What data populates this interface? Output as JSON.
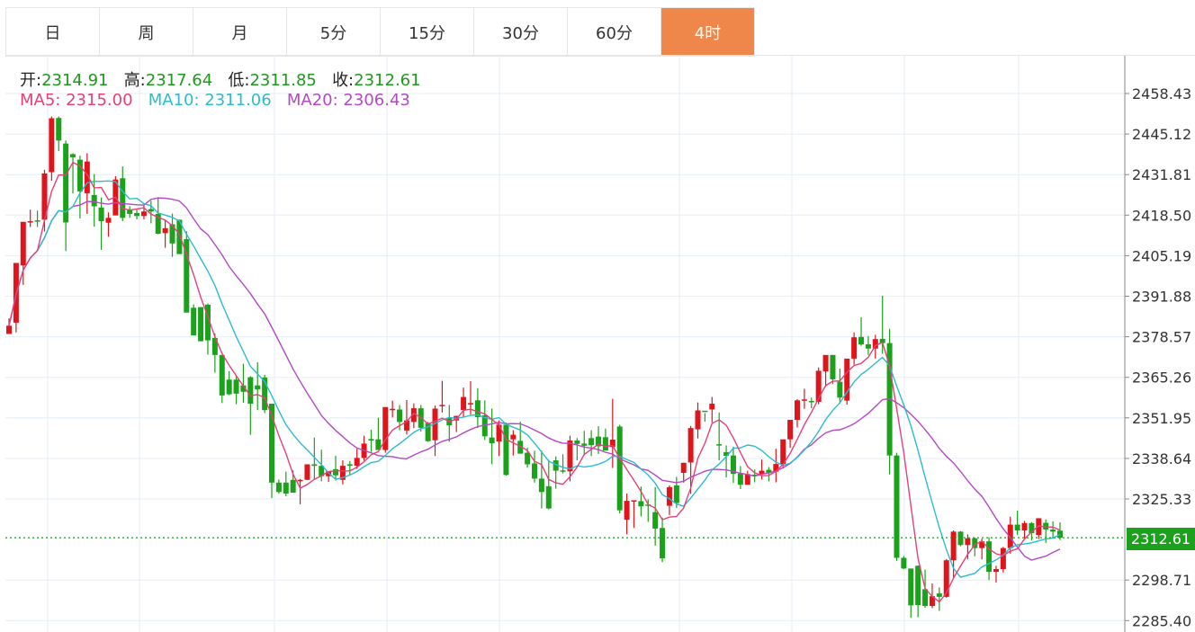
{
  "tabs": [
    {
      "label": "日",
      "active": false
    },
    {
      "label": "周",
      "active": false
    },
    {
      "label": "月",
      "active": false
    },
    {
      "label": "5分",
      "active": false
    },
    {
      "label": "15分",
      "active": false
    },
    {
      "label": "30分",
      "active": false
    },
    {
      "label": "60分",
      "active": false
    },
    {
      "label": "4时",
      "active": true
    }
  ],
  "ohlc": {
    "open_label": "开:",
    "open": "2314.91",
    "high_label": "高:",
    "high": "2317.64",
    "low_label": "低:",
    "low": "2311.85",
    "close_label": "收:",
    "close": "2312.61"
  },
  "ma": {
    "ma5_label": "MA5:",
    "ma5": "2315.00",
    "ma10_label": "MA10:",
    "ma10": "2311.06",
    "ma20_label": "MA20:",
    "ma20": "2306.43"
  },
  "current_price_label": "2312.61",
  "colors": {
    "up": "#e0141b",
    "down": "#1ba11b",
    "ma5": "#e6407a",
    "ma10": "#2bbcd0",
    "ma20": "#b548c6",
    "accent": "#f0874a",
    "grid": "#e4eef6"
  },
  "chart_data": {
    "type": "candlestick",
    "y_ticks": [
      "2458.43",
      "2445.12",
      "2431.81",
      "2418.50",
      "2405.19",
      "2391.88",
      "2378.57",
      "2365.26",
      "2351.95",
      "2338.64",
      "2325.33",
      "2312.61",
      "2298.71",
      "2285.40"
    ],
    "ylim": [
      2282.5,
      2466.0
    ],
    "current_price": 2312.61,
    "candles": [
      [
        2379.5,
        2384.6,
        2379.5,
        2382.2
      ],
      [
        2383.2,
        2402.2,
        2380.0,
        2402.8
      ],
      [
        2402.0,
        2416.3,
        2395.6,
        2416.3
      ],
      [
        2416.4,
        2420.3,
        2414.6,
        2416.5
      ],
      [
        2416.8,
        2420.0,
        2414.6,
        2416.5
      ],
      [
        2417.0,
        2433.4,
        2413.1,
        2432.2
      ],
      [
        2432.6,
        2450.9,
        2429.8,
        2450.3
      ],
      [
        2450.4,
        2450.9,
        2439.5,
        2443.0
      ],
      [
        2442.0,
        2443.0,
        2406.7,
        2416.1
      ],
      [
        2438.5,
        2438.8,
        2425.6,
        2437.5
      ],
      [
        2436.7,
        2438.0,
        2417.4,
        2426.3
      ],
      [
        2425.7,
        2438.8,
        2418.9,
        2436.1
      ],
      [
        2425.1,
        2432.0,
        2414.7,
        2421.4
      ],
      [
        2421.0,
        2424.3,
        2407.1,
        2416.5
      ],
      [
        2416.0,
        2419.4,
        2411.4,
        2417.6
      ],
      [
        2418.4,
        2431.3,
        2418.4,
        2430.2
      ],
      [
        2430.6,
        2434.5,
        2416.5,
        2417.6
      ],
      [
        2420.4,
        2421.4,
        2417.6,
        2418.9
      ],
      [
        2419.2,
        2420.2,
        2417.1,
        2418.2
      ],
      [
        2418.2,
        2421.7,
        2417.1,
        2419.7
      ],
      [
        2420.5,
        2423.2,
        2415.8,
        2419.7
      ],
      [
        2418.9,
        2424.4,
        2412.2,
        2412.4
      ],
      [
        2412.6,
        2416.8,
        2407.8,
        2414.2
      ],
      [
        2415.5,
        2419.0,
        2404.8,
        2409.2
      ],
      [
        2417.0,
        2417.0,
        2406.0,
        2405.7
      ],
      [
        2410.6,
        2413.2,
        2386.8,
        2386.5
      ],
      [
        2388.1,
        2389.2,
        2379.8,
        2379.0
      ],
      [
        2388.3,
        2388.3,
        2377.1,
        2377.1
      ],
      [
        2389.1,
        2389.5,
        2372.7,
        2377.4
      ],
      [
        2378.2,
        2379.7,
        2366.8,
        2372.6
      ],
      [
        2372.6,
        2372.6,
        2356.8,
        2359.3
      ],
      [
        2364.5,
        2367.3,
        2359.4,
        2359.7
      ],
      [
        2364.5,
        2365.7,
        2356.4,
        2359.9
      ],
      [
        2362.6,
        2369.7,
        2356.9,
        2360.5
      ],
      [
        2365.3,
        2365.6,
        2346.4,
        2356.6
      ],
      [
        2362.6,
        2370.2,
        2354.5,
        2361.3
      ],
      [
        2365.2,
        2366.1,
        2353.5,
        2354.5
      ],
      [
        2356.6,
        2356.6,
        2325.6,
        2330.7
      ],
      [
        2330.7,
        2331.7,
        2327.1,
        2327.6
      ],
      [
        2330.7,
        2334.3,
        2326.2,
        2327.1
      ],
      [
        2331.6,
        2334.7,
        2327.7,
        2327.4
      ],
      [
        2331.6,
        2331.9,
        2323.6,
        2331.6
      ],
      [
        2331.6,
        2336.7,
        2331.6,
        2336.7
      ],
      [
        2336.7,
        2345.5,
        2331.6,
        2336.2
      ],
      [
        2336.2,
        2341.5,
        2331.1,
        2332.8
      ],
      [
        2332.8,
        2333.9,
        2330.9,
        2334.4
      ],
      [
        2335.1,
        2339.5,
        2331.4,
        2333.1
      ],
      [
        2331.6,
        2338.0,
        2330.1,
        2336.2
      ],
      [
        2336.7,
        2337.8,
        2333.2,
        2336.2
      ],
      [
        2336.2,
        2341.8,
        2335.2,
        2338.8
      ],
      [
        2338.8,
        2346.1,
        2337.9,
        2343.5
      ],
      [
        2345.0,
        2348.1,
        2340.8,
        2344.5
      ],
      [
        2344.9,
        2352.0,
        2341.8,
        2341.4
      ],
      [
        2341.4,
        2350.6,
        2340.5,
        2355.5
      ],
      [
        2354.8,
        2357.6,
        2352.1,
        2354.9
      ],
      [
        2354.7,
        2356.2,
        2347.9,
        2350.6
      ],
      [
        2347.8,
        2357.8,
        2346.5,
        2351.1
      ],
      [
        2350.6,
        2356.7,
        2348.6,
        2355.1
      ],
      [
        2355.1,
        2356.2,
        2347.5,
        2348.7
      ],
      [
        2350.3,
        2350.6,
        2344.1,
        2344.3
      ],
      [
        2344.6,
        2356.0,
        2339.4,
        2355.0
      ],
      [
        2356.1,
        2364.1,
        2353.7,
        2356.2
      ],
      [
        2351.9,
        2356.2,
        2344.1,
        2349.5
      ],
      [
        2351.1,
        2352.6,
        2347.3,
        2352.6
      ],
      [
        2354.5,
        2361.9,
        2352.2,
        2358.8
      ],
      [
        2356.8,
        2364.0,
        2353.1,
        2356.8
      ],
      [
        2357.7,
        2361.7,
        2348.6,
        2352.2
      ],
      [
        2352.8,
        2357.7,
        2344.7,
        2345.9
      ],
      [
        2345.5,
        2355.0,
        2336.7,
        2343.6
      ],
      [
        2344.2,
        2351.1,
        2339.4,
        2349.7
      ],
      [
        2349.7,
        2350.4,
        2333.0,
        2333.2
      ],
      [
        2344.9,
        2347.9,
        2339.6,
        2346.4
      ],
      [
        2344.4,
        2350.7,
        2340.2,
        2340.2
      ],
      [
        2340.5,
        2342.2,
        2335.6,
        2336.7
      ],
      [
        2337.0,
        2341.2,
        2330.7,
        2332.0
      ],
      [
        2332.0,
        2341.2,
        2322.2,
        2327.6
      ],
      [
        2329.5,
        2338.2,
        2321.9,
        2322.2
      ],
      [
        2338.0,
        2339.3,
        2328.7,
        2334.6
      ],
      [
        2334.7,
        2340.0,
        2333.7,
        2334.4
      ],
      [
        2334.4,
        2346.1,
        2331.1,
        2344.5
      ],
      [
        2344.5,
        2345.3,
        2338.0,
        2343.4
      ],
      [
        2343.5,
        2347.7,
        2339.7,
        2342.8
      ],
      [
        2345.3,
        2347.9,
        2339.4,
        2343.0
      ],
      [
        2345.8,
        2349.2,
        2340.1,
        2342.6
      ],
      [
        2345.6,
        2348.4,
        2341.4,
        2341.2
      ],
      [
        2342.4,
        2358.2,
        2335.5,
        2344.8
      ],
      [
        2349.1,
        2349.7,
        2320.6,
        2321.6
      ],
      [
        2318.5,
        2327.1,
        2313.7,
        2324.7
      ],
      [
        2324.7,
        2324.7,
        2315.8,
        2324.9
      ],
      [
        2324.6,
        2329.4,
        2319.6,
        2322.9
      ],
      [
        2323.5,
        2325.2,
        2317.8,
        2323.4
      ],
      [
        2321.0,
        2329.2,
        2310.0,
        2315.6
      ],
      [
        2315.8,
        2319.2,
        2304.6,
        2305.8
      ],
      [
        2323.1,
        2329.8,
        2320.0,
        2329.2
      ],
      [
        2329.8,
        2332.6,
        2322.4,
        2324.0
      ],
      [
        2333.9,
        2337.2,
        2330.7,
        2337.2
      ],
      [
        2337.3,
        2349.3,
        2327.0,
        2348.6
      ],
      [
        2348.2,
        2357.0,
        2345.2,
        2354.4
      ],
      [
        2354.3,
        2353.5,
        2350.7,
        2353.9
      ],
      [
        2354.7,
        2358.8,
        2350.5,
        2356.6
      ],
      [
        2343.3,
        2353.7,
        2338.0,
        2343.1
      ],
      [
        2340.7,
        2342.9,
        2332.4,
        2339.5
      ],
      [
        2339.6,
        2342.5,
        2330.6,
        2333.6
      ],
      [
        2333.7,
        2336.1,
        2328.6,
        2330.0
      ],
      [
        2330.0,
        2334.6,
        2330.0,
        2333.5
      ],
      [
        2333.3,
        2335.0,
        2330.8,
        2333.2
      ],
      [
        2333.5,
        2338.3,
        2331.7,
        2334.6
      ],
      [
        2334.9,
        2335.8,
        2331.1,
        2333.8
      ],
      [
        2334.3,
        2341.8,
        2330.8,
        2336.8
      ],
      [
        2336.8,
        2344.8,
        2335.3,
        2344.9
      ],
      [
        2344.9,
        2351.3,
        2342.1,
        2351.3
      ],
      [
        2351.3,
        2358.1,
        2348.8,
        2357.7
      ],
      [
        2357.7,
        2361.5,
        2354.9,
        2358.0
      ],
      [
        2357.5,
        2358.6,
        2355.1,
        2357.2
      ],
      [
        2357.2,
        2368.5,
        2356.4,
        2367.4
      ],
      [
        2367.2,
        2371.2,
        2362.2,
        2372.6
      ],
      [
        2372.6,
        2372.6,
        2363.0,
        2364.6
      ],
      [
        2363.8,
        2368.1,
        2356.7,
        2358.6
      ],
      [
        2357.6,
        2371.1,
        2356.3,
        2371.4
      ],
      [
        2371.4,
        2380.0,
        2369.4,
        2378.4
      ],
      [
        2378.5,
        2385.0,
        2375.6,
        2376.1
      ],
      [
        2376.1,
        2378.8,
        2372.6,
        2374.7
      ],
      [
        2374.7,
        2379.2,
        2371.4,
        2377.8
      ],
      [
        2377.9,
        2392.0,
        2373.0,
        2376.5
      ],
      [
        2376.5,
        2381.2,
        2333.4,
        2339.6
      ],
      [
        2339.6,
        2340.5,
        2305.0,
        2306.0
      ],
      [
        2306.0,
        2306.6,
        2302.3,
        2302.5
      ],
      [
        2302.5,
        2302.4,
        2286.3,
        2290.4
      ],
      [
        2303.4,
        2303.5,
        2286.5,
        2290.5
      ],
      [
        2295.7,
        2302.1,
        2289.6,
        2290.2
      ],
      [
        2290.2,
        2297.6,
        2289.5,
        2293.4
      ],
      [
        2294.3,
        2296.3,
        2288.6,
        2293.2
      ],
      [
        2293.2,
        2305.6,
        2292.9,
        2305.2
      ],
      [
        2305.2,
        2315.0,
        2299.5,
        2314.6
      ],
      [
        2314.6,
        2314.8,
        2309.8,
        2310.2
      ],
      [
        2310.2,
        2313.7,
        2305.5,
        2312.4
      ],
      [
        2312.4,
        2312.7,
        2306.5,
        2309.2
      ],
      [
        2309.2,
        2312.3,
        2305.5,
        2311.4
      ],
      [
        2311.4,
        2312.8,
        2298.7,
        2301.4
      ],
      [
        2301.4,
        2303.4,
        2297.9,
        2302.3
      ],
      [
        2302.3,
        2309.6,
        2301.2,
        2309.2
      ],
      [
        2309.2,
        2319.5,
        2307.4,
        2316.9
      ],
      [
        2316.9,
        2321.5,
        2313.5,
        2315.0
      ],
      [
        2315.0,
        2318.1,
        2312.2,
        2317.4
      ],
      [
        2317.4,
        2317.7,
        2311.7,
        2314.1
      ],
      [
        2313.5,
        2319.0,
        2312.2,
        2319.0
      ],
      [
        2317.5,
        2318.6,
        2310.9,
        2315.3
      ],
      [
        2315.3,
        2318.0,
        2312.5,
        2314.6
      ],
      [
        2314.91,
        2317.64,
        2311.85,
        2312.61
      ]
    ]
  }
}
